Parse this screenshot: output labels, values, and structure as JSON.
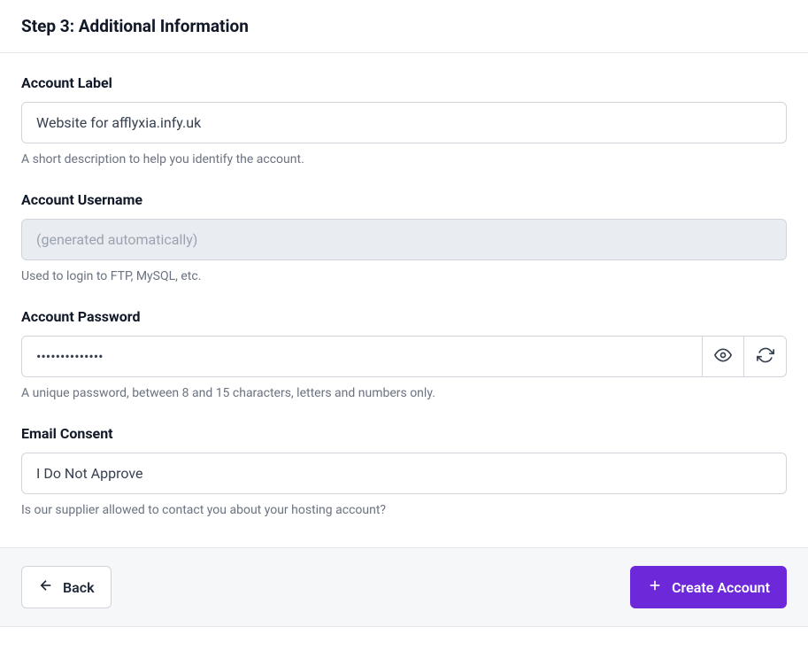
{
  "header": {
    "title": "Step 3: Additional Information"
  },
  "fields": {
    "label": {
      "label": "Account Label",
      "value": "Website for afflyxia.infy.uk",
      "helper": "A short description to help you identify the account."
    },
    "username": {
      "label": "Account Username",
      "placeholder": "(generated automatically)",
      "helper": "Used to login to FTP, MySQL, etc."
    },
    "password": {
      "label": "Account Password",
      "value": "••••••••••••••",
      "helper": "A unique password, between 8 and 15 characters, letters and numbers only."
    },
    "consent": {
      "label": "Email Consent",
      "value": "I Do Not Approve",
      "helper": "Is our supplier allowed to contact you about your hosting account?"
    }
  },
  "footer": {
    "back_label": "Back",
    "create_label": "Create Account"
  }
}
